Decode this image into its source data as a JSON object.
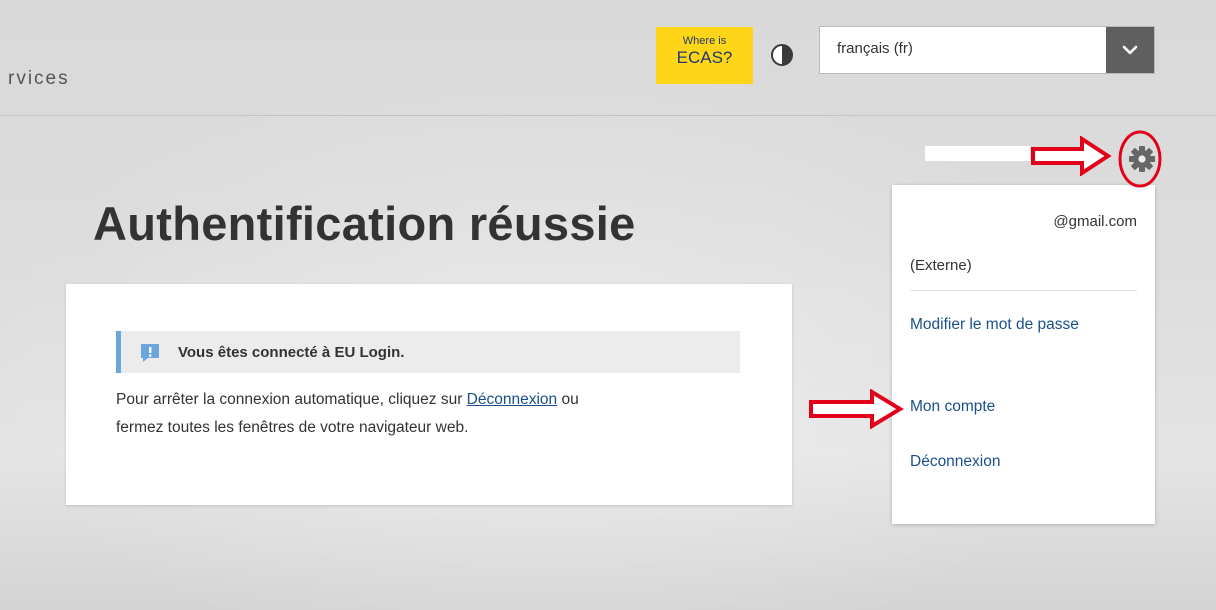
{
  "header": {
    "site_name": "rvices",
    "ecas_button": {
      "line1": "Where is",
      "line2": "ECAS?"
    },
    "contrast_icon": "contrast-icon",
    "language": {
      "selected": "français (fr)",
      "icon": "chevron-down-icon"
    },
    "settings_icon": "gear-icon"
  },
  "main": {
    "title": "Authentification réussie",
    "banner": {
      "icon": "info-icon",
      "text": "Vous êtes connecté à EU Login."
    },
    "body": {
      "before_link": "Pour arrêter la connexion automatique, cliquez sur ",
      "link": "Déconnexion",
      "after_link": " ou",
      "line2": "fermez toutes les fenêtres de votre navigateur web."
    }
  },
  "user_menu": {
    "email": "@gmail.com",
    "user_type": "(Externe)",
    "items": [
      {
        "label": "Modifier le mot de passe"
      },
      {
        "label": "Mon compte"
      },
      {
        "label": "Déconnexion"
      }
    ]
  },
  "colors": {
    "accent_yellow": "#ffd617",
    "link_blue": "#1a4f8b",
    "info_blue": "#6aa6dc",
    "annotation_red": "#e3001b"
  }
}
